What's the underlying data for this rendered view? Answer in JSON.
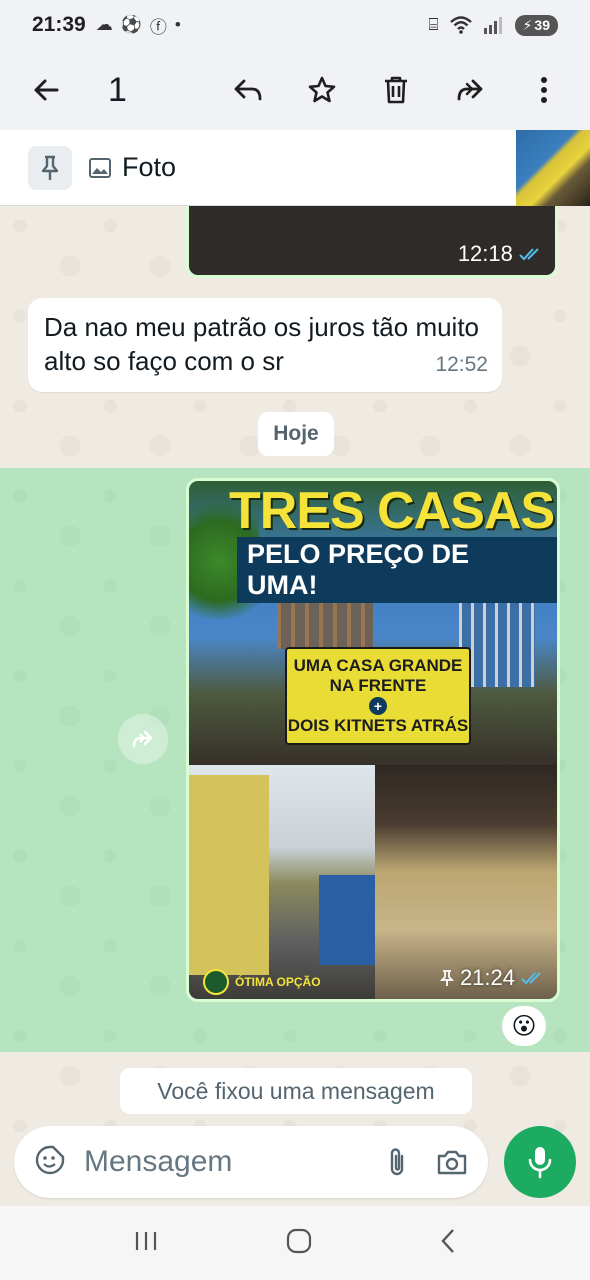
{
  "status_bar": {
    "time": "21:39",
    "battery": "39"
  },
  "top_bar": {
    "selected_count": "1"
  },
  "pinned": {
    "label": "Foto"
  },
  "messages": {
    "outgoing_image_top_time": "12:18",
    "incoming_text": "Da nao meu patrão os juros tão muito alto so faço com o sr",
    "incoming_time": "12:52",
    "date_chip": "Hoje",
    "photo": {
      "headline": "TRES CASAS",
      "subheadline": "PELO PREÇO DE UMA!",
      "box_line1": "UMA CASA GRANDE",
      "box_line2": "NA FRENTE",
      "box_plus": "+",
      "box_line3": "DOIS KITNETS ATRÁS",
      "footer": "ÓTIMA OPÇÃO",
      "time": "21:24"
    },
    "reaction": "😮",
    "system": "Você fixou uma mensagem"
  },
  "composer": {
    "placeholder": "Mensagem"
  },
  "colors": {
    "accent": "#1daa61",
    "outgoing_bubble": "#d9fdd3",
    "selection": "#25d366",
    "read_ticks": "#53bdeb"
  }
}
